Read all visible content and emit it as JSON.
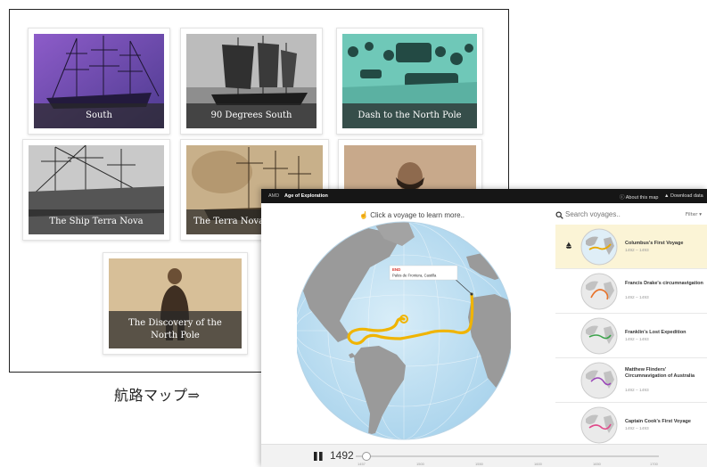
{
  "gallery": {
    "cards": [
      {
        "title": "South",
        "theme": "purple"
      },
      {
        "title": "90 Degrees South",
        "theme": "grey"
      },
      {
        "title": "Dash to the North Pole",
        "theme": "teal"
      },
      {
        "title": "The Ship Terra Nova",
        "theme": "grey"
      },
      {
        "title": "The Terra Nova F",
        "theme": "sepia"
      },
      {
        "title": "",
        "theme": "portrait"
      },
      {
        "title": "The Discovery of the North Pole",
        "theme": "sepia"
      }
    ],
    "colors": {
      "purple": "#6d4fa3",
      "teal": "#55b7a8",
      "sepia": "#b59a74",
      "grey": "#8c8c8c"
    }
  },
  "caption_jp": "航路マップ⇒",
  "app": {
    "brand": "AMD",
    "title": "Age of Exploration",
    "about_label": "About this map",
    "download_label": "Download data",
    "prompt": "Click a voyage to learn more..",
    "search": {
      "placeholder": "Search voyages..",
      "filter_label": "Filter"
    },
    "map_label": {
      "tag": "END",
      "place": "Palos de Frontera, Castilla"
    },
    "voyages": [
      {
        "name": "Columbus's First Voyage",
        "years": "1492 – 1493",
        "color": "#e8a800",
        "selected": true
      },
      {
        "name": "Francis Drake's circumnavigation",
        "years": "1492 – 1493",
        "color": "#e8732b",
        "selected": false
      },
      {
        "name": "Franklin's Lost Expedition",
        "years": "1492 – 1493",
        "color": "#3ca24b",
        "selected": false
      },
      {
        "name": "Matthew Flinders' Circumnavigation of Australia",
        "years": "1492 – 1493",
        "color": "#9a47b8",
        "selected": false
      },
      {
        "name": "Captain Cook's First Voyage",
        "years": "1492 – 1493",
        "color": "#e04a8a",
        "selected": false
      }
    ],
    "timeline": {
      "current_year": "1492",
      "ticks": [
        "1457",
        "1500",
        "1550",
        "1600",
        "1650",
        "1700"
      ]
    },
    "colors": {
      "route": "#f0b400",
      "ocean": "#bfe0f2",
      "land": "#9c9c9c"
    }
  }
}
